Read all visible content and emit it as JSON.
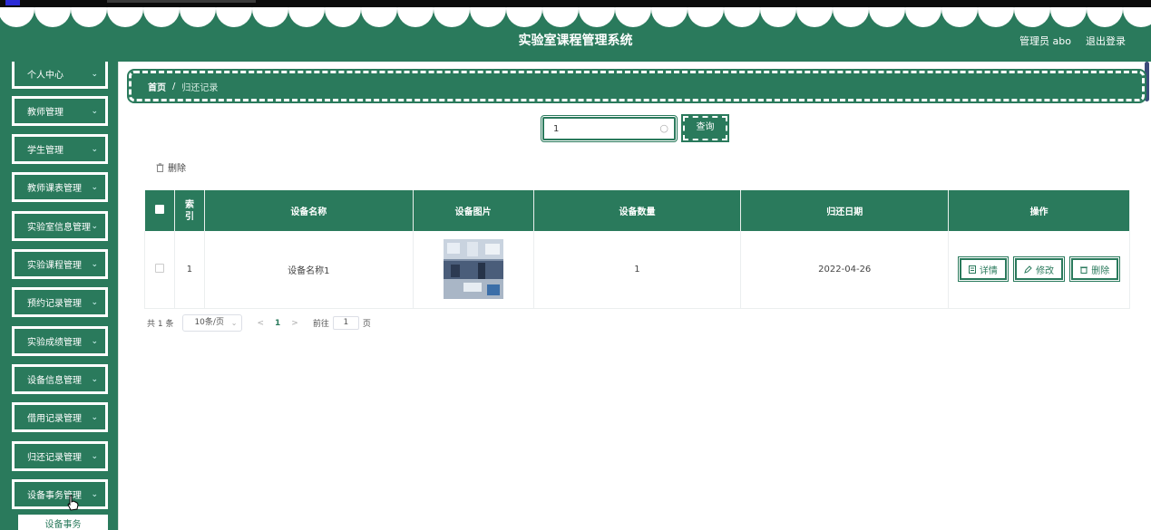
{
  "header": {
    "title": "实验室课程管理系统",
    "user_label": "管理员 abo",
    "logout_label": "退出登录"
  },
  "sidebar": {
    "items": [
      {
        "label": "个人中心"
      },
      {
        "label": "教师管理"
      },
      {
        "label": "学生管理"
      },
      {
        "label": "教师课表管理"
      },
      {
        "label": "实验室信息管理"
      },
      {
        "label": "实验课程管理"
      },
      {
        "label": "预约记录管理"
      },
      {
        "label": "实验成绩管理"
      },
      {
        "label": "设备信息管理"
      },
      {
        "label": "借用记录管理"
      },
      {
        "label": "归还记录管理"
      },
      {
        "label": "设备事务管理"
      }
    ],
    "submenu_label": "设备事务"
  },
  "breadcrumb": {
    "home": "首页",
    "separator": "/",
    "current": "归还记录"
  },
  "search": {
    "value": "1",
    "button_label": "查询"
  },
  "toolbar": {
    "delete_label": "删除"
  },
  "table": {
    "headers": [
      "索引",
      "设备名称",
      "设备图片",
      "设备数量",
      "归还日期",
      "操作"
    ],
    "rows": [
      {
        "index": "1",
        "name": "设备名称1",
        "quantity": "1",
        "date": "2022-04-26"
      }
    ],
    "actions": {
      "detail": "详情",
      "edit": "修改",
      "delete": "删除"
    }
  },
  "pagination": {
    "total_text": "共 1 条",
    "page_size": "10条/页",
    "current_page": "1",
    "goto_label": "前往",
    "goto_value": "1",
    "page_unit": "页"
  },
  "colors": {
    "primary": "#2a7a5c",
    "text": "#333333"
  }
}
